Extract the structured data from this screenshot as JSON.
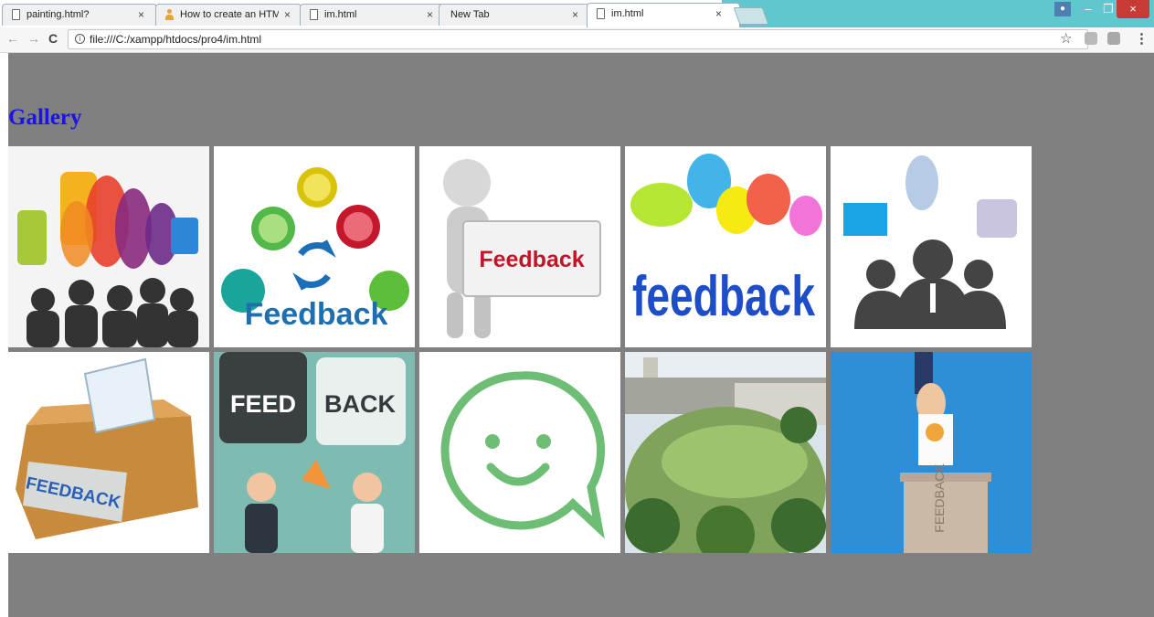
{
  "browser": {
    "tabs": [
      {
        "title": "painting.html?",
        "close": "×"
      },
      {
        "title": "How to create an HTML t",
        "close": "×"
      },
      {
        "title": "im.html",
        "close": "×"
      },
      {
        "title": "New Tab",
        "close": "×"
      },
      {
        "title": "im.html",
        "close": "×"
      }
    ],
    "url": "file:///C:/xampp/htdocs/pro4/im.html",
    "icons": {
      "back": "←",
      "forward": "→",
      "reload": "C",
      "info": "i",
      "star": "☆",
      "menu": "⋮",
      "minimize": "–",
      "maximize": "❐",
      "close": "×",
      "user": "●"
    }
  },
  "page": {
    "heading": "Gallery",
    "background": "#808080",
    "heading_color": "#1a14e6",
    "gallery": [
      {
        "image": "speech-bubbles-crowd-image"
      },
      {
        "image": "feedback-emoji-bubbles-image"
      },
      {
        "image": "figure-holding-feedback-sign-image",
        "text": "Feedback"
      },
      {
        "image": "feedback-word-clouds-image",
        "text": "feedback"
      },
      {
        "image": "three-people-speech-bubbles-image"
      },
      {
        "image": "feedback-ballot-box-image",
        "text": "FEEDBACK"
      },
      {
        "image": "feed-back-conversation-image",
        "text": [
          "FEED",
          "BACK"
        ]
      },
      {
        "image": "smile-chat-bubble-image"
      },
      {
        "image": "campus-field-photo-image"
      },
      {
        "image": "hand-voting-box-image",
        "text": "FEEDBACK"
      }
    ]
  }
}
